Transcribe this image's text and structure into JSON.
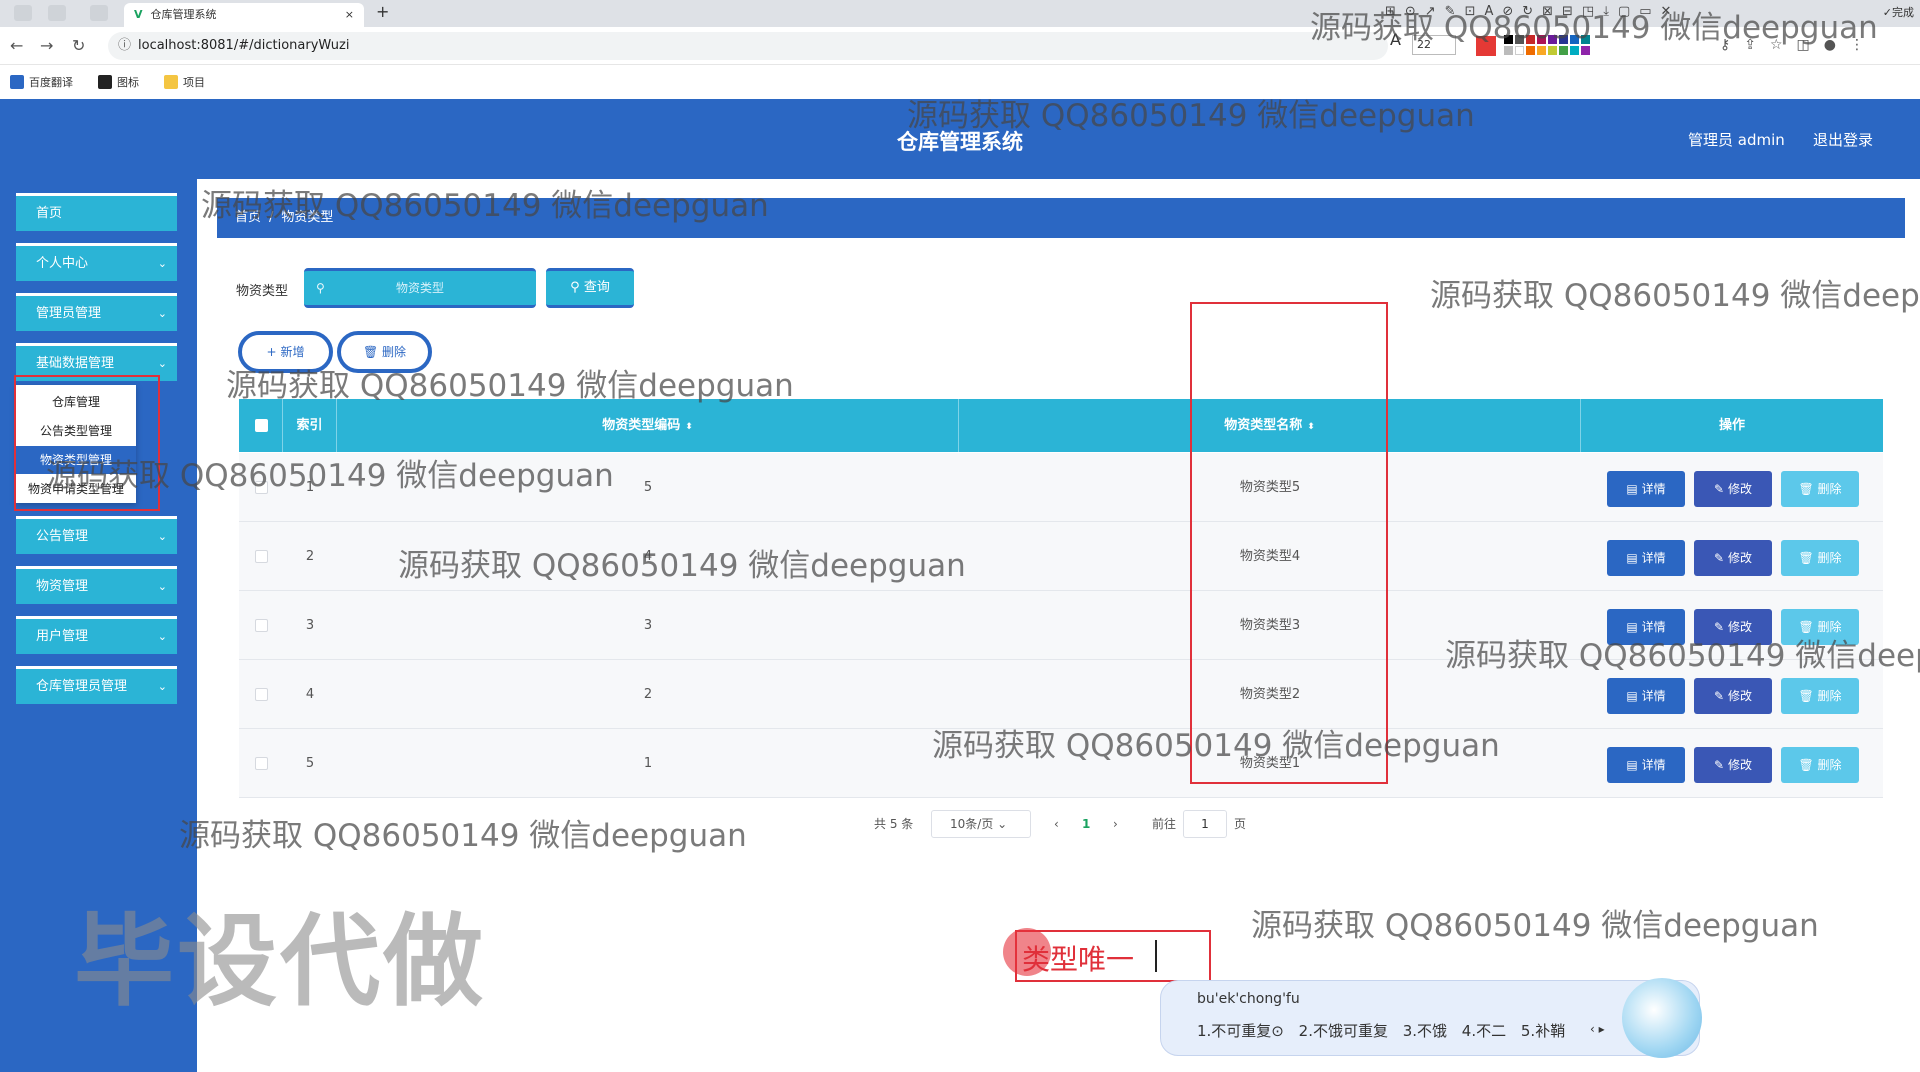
{
  "browser": {
    "tab_title": "仓库管理系统",
    "tab_close": "×",
    "tab_new": "+",
    "url": "localhost:8081/#/dictionaryWuzi",
    "font_size": "22",
    "done_label": "✓完成",
    "bookmarks": [
      "百度翻译",
      "图标",
      "项目"
    ]
  },
  "app": {
    "title": "仓库管理系统",
    "user_label": "管理员 admin",
    "logout_label": "退出登录"
  },
  "sidebar": {
    "items": [
      {
        "label": "首页"
      },
      {
        "label": "个人中心"
      },
      {
        "label": "管理员管理"
      },
      {
        "label": "基础数据管理"
      },
      {
        "label": "公告管理"
      },
      {
        "label": "物资管理"
      },
      {
        "label": "用户管理"
      },
      {
        "label": "仓库管理员管理"
      }
    ],
    "submenu": [
      "仓库管理",
      "公告类型管理",
      "物资类型管理",
      "物资申请类型管理"
    ]
  },
  "breadcrumb": {
    "home": "首页",
    "sep": "/",
    "current": "物资类型"
  },
  "search": {
    "label": "物资类型",
    "placeholder": "物资类型",
    "query_label": "查询"
  },
  "actions": {
    "add_label": "新增",
    "delete_label": "删除"
  },
  "table": {
    "headers": {
      "index": "索引",
      "code": "物资类型编码",
      "name": "物资类型名称",
      "ops": "操作"
    },
    "sort_glyph": "⬍",
    "rows": [
      {
        "index": "1",
        "code": "5",
        "name": "物资类型5"
      },
      {
        "index": "2",
        "code": "4",
        "name": "物资类型4"
      },
      {
        "index": "3",
        "code": "3",
        "name": "物资类型3"
      },
      {
        "index": "4",
        "code": "2",
        "name": "物资类型2"
      },
      {
        "index": "5",
        "code": "1",
        "name": "物资类型1"
      }
    ],
    "row_actions": {
      "detail": "详情",
      "edit": "修改",
      "delete": "删除"
    }
  },
  "pagination": {
    "total": "共 5 条",
    "page_size": "10条/页",
    "prev": "‹",
    "current": "1",
    "next": "›",
    "goto_label": "前往",
    "goto_value": "1",
    "page_suffix": "页"
  },
  "overlays": {
    "watermark": "源码获取 QQ86050149 微信deepguan",
    "big_watermark": "毕设代做",
    "tooltip_text": "类型唯一",
    "ime_composition": "bu'ek'chong'fu",
    "ime_candidates": "1.不可重复⊙ 2.不饿可重复 3.不饿 4.不二 5.补鞘",
    "ime_arrows": "‹ ▸"
  },
  "colors": {
    "primary": "#2b67c3",
    "accent": "#2bb4d6",
    "highlight": "#e0303a"
  }
}
